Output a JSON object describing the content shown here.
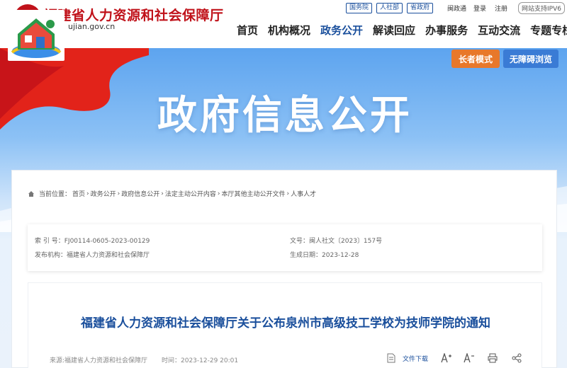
{
  "header": {
    "site_title": "福建省人力资源和社会保障厅",
    "domain_text": "ujian.gov.cn",
    "top_links": [
      "国务院",
      "人社部",
      "省政府"
    ],
    "top_texts": [
      "闽政通",
      "登录",
      "注册"
    ],
    "ipv6": "网站支持IPV6"
  },
  "nav": {
    "items": [
      "首页",
      "机构概况",
      "政务公开",
      "解读回应",
      "办事服务",
      "互动交流",
      "专题专栏"
    ],
    "active_index": 2
  },
  "banner": {
    "title": "政府信息公开",
    "elder_mode": "长者模式",
    "accessible": "无障碍浏览"
  },
  "breadcrumb": {
    "label": "当前位置：",
    "items": [
      "首页",
      "政务公开",
      "政府信息公开",
      "法定主动公开内容",
      "本厅其他主动公开文件",
      "人事人才"
    ]
  },
  "meta": {
    "index_label": "索 引 号：",
    "index_value": "FJ00114-0605-2023-00129",
    "doc_label": "文号：",
    "doc_value": "闽人社文〔2023〕157号",
    "publisher_label": "发布机构：",
    "publisher_value": "福建省人力资源和社会保障厅",
    "date_label": "生成日期：",
    "date_value": "2023-12-28"
  },
  "article": {
    "title": "福建省人力资源和社会保障厅关于公布泉州市高级技工学校为技师学院的通知",
    "source": "来源:福建省人力资源和社会保障厅",
    "time": "时间：2023-12-29 20:01",
    "download": "文件下载"
  },
  "colors": {
    "brand_red": "#c0121a",
    "brand_blue": "#1a4f9c",
    "elder_orange": "#e8782a",
    "access_blue": "#3a7bd5"
  },
  "icons": [
    "home-icon",
    "document-icon",
    "font-increase-icon",
    "font-decrease-icon",
    "print-icon",
    "share-icon"
  ]
}
